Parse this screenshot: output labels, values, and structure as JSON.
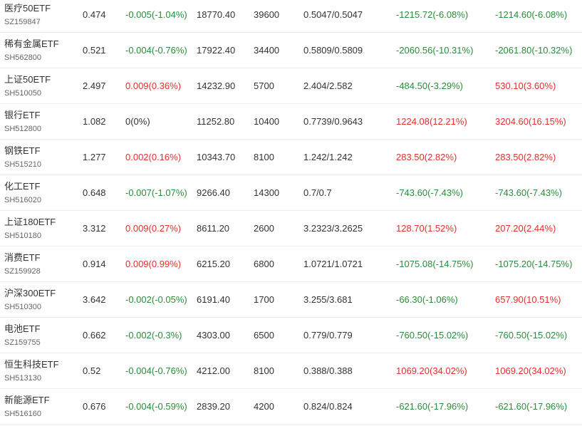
{
  "colors": {
    "up": "#e0312c",
    "down": "#2a8d3a",
    "flat": "#333333"
  },
  "rows": [
    {
      "name": "医疗50ETF",
      "code": "SZ159847",
      "price": "0.474",
      "change": "-0.005(-1.04%)",
      "change_dir": "down",
      "amount": "18770.40",
      "volume": "39600",
      "range": "0.5047/0.5047",
      "ret1": "-1215.72(-6.08%)",
      "ret1_dir": "down",
      "ret2": "-1214.60(-6.08%)",
      "ret2_dir": "down"
    },
    {
      "name": "稀有金属ETF",
      "code": "SH562800",
      "price": "0.521",
      "change": "-0.004(-0.76%)",
      "change_dir": "down",
      "amount": "17922.40",
      "volume": "34400",
      "range": "0.5809/0.5809",
      "ret1": "-2060.56(-10.31%)",
      "ret1_dir": "down",
      "ret2": "-2061.80(-10.32%)",
      "ret2_dir": "down"
    },
    {
      "name": "上证50ETF",
      "code": "SH510050",
      "price": "2.497",
      "change": "0.009(0.36%)",
      "change_dir": "up",
      "amount": "14232.90",
      "volume": "5700",
      "range": "2.404/2.582",
      "ret1": "-484.50(-3.29%)",
      "ret1_dir": "down",
      "ret2": "530.10(3.60%)",
      "ret2_dir": "up"
    },
    {
      "name": "银行ETF",
      "code": "SH512800",
      "price": "1.082",
      "change": "0(0%)",
      "change_dir": "flat",
      "amount": "11252.80",
      "volume": "10400",
      "range": "0.7739/0.9643",
      "ret1": "1224.08(12.21%)",
      "ret1_dir": "up",
      "ret2": "3204.60(16.15%)",
      "ret2_dir": "up"
    },
    {
      "name": "钢铁ETF",
      "code": "SH515210",
      "price": "1.277",
      "change": "0.002(0.16%)",
      "change_dir": "up",
      "amount": "10343.70",
      "volume": "8100",
      "range": "1.242/1.242",
      "ret1": "283.50(2.82%)",
      "ret1_dir": "up",
      "ret2": "283.50(2.82%)",
      "ret2_dir": "up"
    },
    {
      "name": "化工ETF",
      "code": "SH516020",
      "price": "0.648",
      "change": "-0.007(-1.07%)",
      "change_dir": "down",
      "amount": "9266.40",
      "volume": "14300",
      "range": "0.7/0.7",
      "ret1": "-743.60(-7.43%)",
      "ret1_dir": "down",
      "ret2": "-743.60(-7.43%)",
      "ret2_dir": "down"
    },
    {
      "name": "上证180ETF",
      "code": "SH510180",
      "price": "3.312",
      "change": "0.009(0.27%)",
      "change_dir": "up",
      "amount": "8611.20",
      "volume": "2600",
      "range": "3.2323/3.2625",
      "ret1": "128.70(1.52%)",
      "ret1_dir": "up",
      "ret2": "207.20(2.44%)",
      "ret2_dir": "up"
    },
    {
      "name": "消费ETF",
      "code": "SZ159928",
      "price": "0.914",
      "change": "0.009(0.99%)",
      "change_dir": "up",
      "amount": "6215.20",
      "volume": "6800",
      "range": "1.0721/1.0721",
      "ret1": "-1075.08(-14.75%)",
      "ret1_dir": "down",
      "ret2": "-1075.20(-14.75%)",
      "ret2_dir": "down"
    },
    {
      "name": "沪深300ETF",
      "code": "SH510300",
      "price": "3.642",
      "change": "-0.002(-0.05%)",
      "change_dir": "down",
      "amount": "6191.40",
      "volume": "1700",
      "range": "3.255/3.681",
      "ret1": "-66.30(-1.06%)",
      "ret1_dir": "down",
      "ret2": "657.90(10.51%)",
      "ret2_dir": "up"
    },
    {
      "name": "电池ETF",
      "code": "SZ159755",
      "price": "0.662",
      "change": "-0.002(-0.3%)",
      "change_dir": "down",
      "amount": "4303.00",
      "volume": "6500",
      "range": "0.779/0.779",
      "ret1": "-760.50(-15.02%)",
      "ret1_dir": "down",
      "ret2": "-760.50(-15.02%)",
      "ret2_dir": "down"
    },
    {
      "name": "恒生科技ETF",
      "code": "SH513130",
      "price": "0.52",
      "change": "-0.004(-0.76%)",
      "change_dir": "down",
      "amount": "4212.00",
      "volume": "8100",
      "range": "0.388/0.388",
      "ret1": "1069.20(34.02%)",
      "ret1_dir": "up",
      "ret2": "1069.20(34.02%)",
      "ret2_dir": "up"
    },
    {
      "name": "新能源ETF",
      "code": "SH516160",
      "price": "0.676",
      "change": "-0.004(-0.59%)",
      "change_dir": "down",
      "amount": "2839.20",
      "volume": "4200",
      "range": "0.824/0.824",
      "ret1": "-621.60(-17.96%)",
      "ret1_dir": "down",
      "ret2": "-621.60(-17.96%)",
      "ret2_dir": "down"
    }
  ]
}
